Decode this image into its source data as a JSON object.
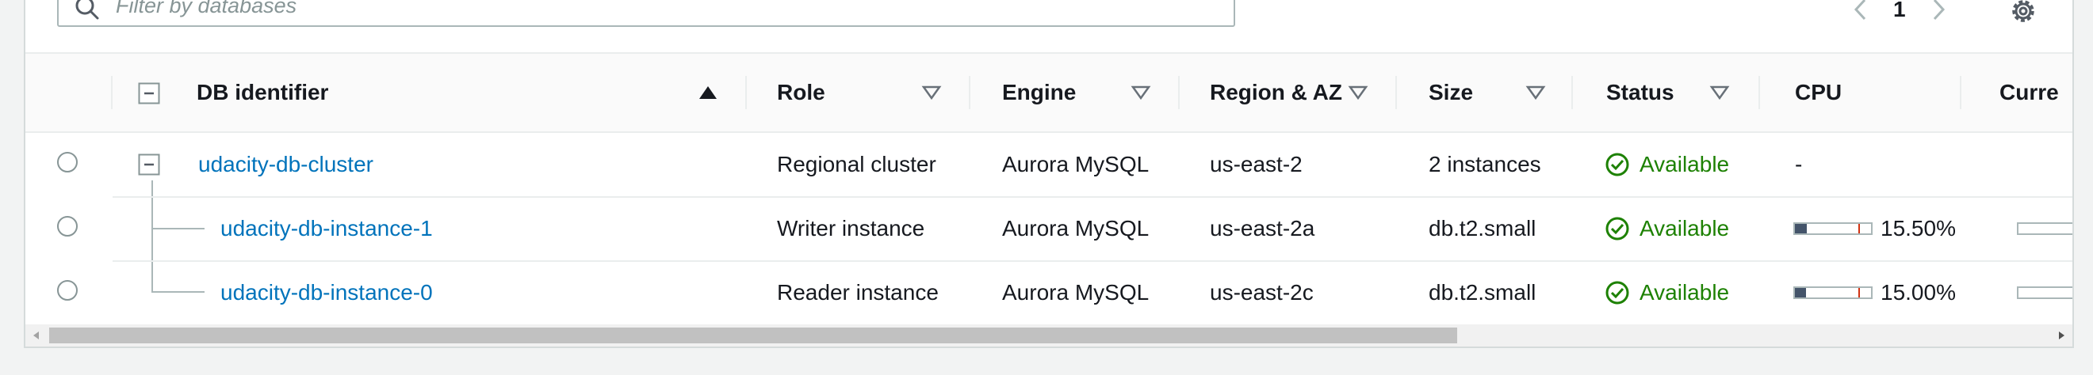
{
  "filter": {
    "placeholder": "Filter by databases"
  },
  "pagination": {
    "page": "1"
  },
  "columns": {
    "db_identifier": "DB identifier",
    "role": "Role",
    "engine": "Engine",
    "region": "Region & AZ",
    "size": "Size",
    "status": "Status",
    "cpu": "CPU",
    "current": "Curre"
  },
  "rows": [
    {
      "id": "udacity-db-cluster",
      "role": "Regional cluster",
      "engine": "Aurora MySQL",
      "region": "us-east-2",
      "size": "2 instances",
      "status": "Available",
      "cpu": "-"
    },
    {
      "id": "udacity-db-instance-1",
      "role": "Writer instance",
      "engine": "Aurora MySQL",
      "region": "us-east-2a",
      "size": "db.t2.small",
      "status": "Available",
      "cpu": "15.50%",
      "cpu_fraction": 0.155
    },
    {
      "id": "udacity-db-instance-0",
      "role": "Reader instance",
      "engine": "Aurora MySQL",
      "region": "us-east-2c",
      "size": "db.t2.small",
      "status": "Available",
      "cpu": "15.00%",
      "cpu_fraction": 0.15
    }
  ],
  "colors": {
    "link": "#0073bb",
    "available": "#1d8102",
    "cpu_fill": "#44546a",
    "cpu_tick": "#d13212"
  },
  "icons": [
    "search-icon",
    "chevron-left-icon",
    "chevron-right-icon",
    "gear-icon",
    "collapse-icon",
    "sort-ascending-icon",
    "sort-descending-icon",
    "status-available-icon"
  ]
}
